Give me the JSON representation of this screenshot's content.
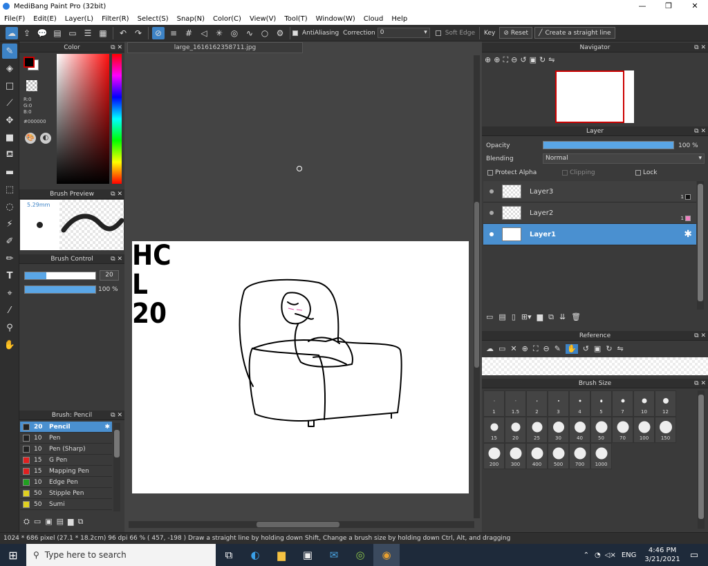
{
  "window": {
    "title": "MediBang Paint Pro (32bit)",
    "minimize": "—",
    "maximize": "❐",
    "close": "✕"
  },
  "menu": [
    "File(F)",
    "Edit(E)",
    "Layer(L)",
    "Filter(R)",
    "Select(S)",
    "Snap(N)",
    "Color(C)",
    "View(V)",
    "Tool(T)",
    "Window(W)",
    "Cloud",
    "Help"
  ],
  "toolbar": {
    "antialiasing": "AntiAliasing",
    "correction_label": "Correction",
    "correction_value": "0",
    "soft_edge": "Soft Edge",
    "key": "Key",
    "reset": "Reset",
    "straight_line": "Create a straight line"
  },
  "color_panel": {
    "title": "Color",
    "r": "R:0",
    "g": "G:0",
    "b": "B:0",
    "hex": "#000000",
    "primary": "#000000",
    "secondary": "#ffffff"
  },
  "brush_preview": {
    "title": "Brush Preview",
    "size": "5.29mm"
  },
  "brush_control": {
    "title": "Brush Control",
    "size_value": "20",
    "opacity_value": "100 %",
    "size_fraction": 0.3,
    "opacity_fraction": 1.0
  },
  "brush_list": {
    "title": "Brush: Pencil",
    "items": [
      {
        "size": "20",
        "name": "Pencil",
        "color": "#222222"
      },
      {
        "size": "10",
        "name": "Pen",
        "color": "#222222"
      },
      {
        "size": "10",
        "name": "Pen (Sharp)",
        "color": "#222222"
      },
      {
        "size": "15",
        "name": "G Pen",
        "color": "#e02020"
      },
      {
        "size": "15",
        "name": "Mapping Pen",
        "color": "#e02020"
      },
      {
        "size": "10",
        "name": "Edge Pen",
        "color": "#20a020"
      },
      {
        "size": "50",
        "name": "Stipple Pen",
        "color": "#e0d020"
      },
      {
        "size": "50",
        "name": "Sumi",
        "color": "#e0d020"
      }
    ]
  },
  "document": {
    "tab": "large_1616162358711.jpg"
  },
  "canvas_text": {
    "line1": "HC",
    "line2": "L",
    "line3": "20"
  },
  "navigator": {
    "title": "Navigator"
  },
  "layer_panel": {
    "title": "Layer",
    "opacity_label": "Opacity",
    "opacity_value": "100 %",
    "opacity_fraction": 1.0,
    "blending_label": "Blending",
    "blending_value": "Normal",
    "protect_alpha": "Protect Alpha",
    "clipping": "Clipping",
    "lock": "Lock",
    "layers": [
      {
        "name": "Layer3",
        "badge": "1",
        "swatch": "#111111"
      },
      {
        "name": "Layer2",
        "badge": "1",
        "swatch": "#f080c0"
      },
      {
        "name": "Layer1",
        "badge": "",
        "swatch": ""
      }
    ]
  },
  "reference": {
    "title": "Reference"
  },
  "brush_size": {
    "title": "Brush Size",
    "sizes": [
      "1",
      "1.5",
      "2",
      "3",
      "4",
      "5",
      "7",
      "10",
      "12",
      "15",
      "20",
      "25",
      "30",
      "40",
      "50",
      "70",
      "100",
      "150",
      "200",
      "300",
      "400",
      "500",
      "700",
      "1000"
    ]
  },
  "status": "1024 * 686 pixel  (27.1 * 18.2cm)  96 dpi  66 %  ( 457, -198 )  Draw a straight line by holding down Shift, Change a brush size by holding down Ctrl, Alt, and dragging",
  "taskbar": {
    "search_placeholder": "Type here to search",
    "lang": "ENG",
    "time": "4:46 PM",
    "date": "3/21/2021"
  }
}
